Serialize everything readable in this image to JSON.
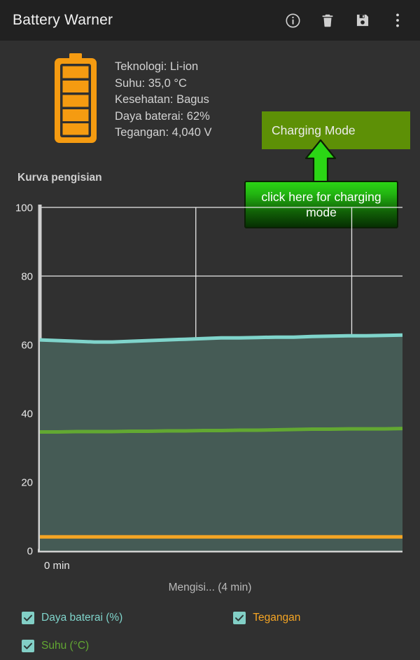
{
  "app": {
    "title": "Battery Warner"
  },
  "toolbar": {
    "icons": [
      {
        "name": "info-icon",
        "label": "Info"
      },
      {
        "name": "delete-icon",
        "label": "Delete"
      },
      {
        "name": "save-icon",
        "label": "Save"
      },
      {
        "name": "overflow-menu-icon",
        "label": "More options"
      }
    ]
  },
  "battery_info": {
    "technology": "Teknologi: Li-ion",
    "temperature": "Suhu: 35,0 °C",
    "health": "Kesehatan: Bagus",
    "level": "Daya baterai: 62%",
    "voltage": "Tegangan: 4,040 V"
  },
  "charging_button": {
    "label": "Charging Mode"
  },
  "tooltip": {
    "text": "click here for charging mode"
  },
  "chart": {
    "title": "Kurva pengisian",
    "x_axis_label": "0 min"
  },
  "status": {
    "text": "Mengisi... (4 min)"
  },
  "legend": {
    "items": [
      {
        "label": "Daya baterai (%)",
        "color": "#7fd4cb",
        "checked": true
      },
      {
        "label": "Tegangan",
        "color": "#f5a524",
        "checked": true
      },
      {
        "label": "Suhu (°C)",
        "color": "#62a832",
        "checked": true
      }
    ]
  },
  "colors": {
    "toolbar_bg": "#212121",
    "page_bg": "#303030",
    "accent_orange": "#f59b11",
    "battery_pct_line": "#7fd4cb",
    "battery_pct_fill": "#455b55",
    "temperature_line": "#62a832",
    "voltage_line": "#f5a524",
    "charging_btn_bg": "#5d9006",
    "tooltip_green": "#2bd615",
    "gridline": "#e8e8e8"
  },
  "chart_data": {
    "type": "line",
    "title": "Kurva pengisian",
    "xlabel": "0 min",
    "ylabel": "",
    "ylim": [
      0,
      100
    ],
    "yticks": [
      0,
      20,
      40,
      60,
      80,
      100
    ],
    "xlim": [
      0,
      4
    ],
    "xticks": [
      0
    ],
    "grid": true,
    "legend_position": "bottom",
    "x": [
      0,
      0.2,
      0.4,
      0.6,
      0.8,
      1.0,
      1.2,
      1.4,
      1.6,
      1.8,
      2.0,
      2.2,
      2.4,
      2.6,
      2.8,
      3.0,
      3.2,
      3.4,
      3.6,
      3.8,
      4.0
    ],
    "series": [
      {
        "name": "Daya baterai (%)",
        "color": "#7fd4cb",
        "filled": true,
        "values": [
          61.4,
          61.2,
          61.0,
          60.8,
          60.8,
          61.0,
          61.2,
          61.4,
          61.6,
          61.8,
          62.0,
          62.0,
          62.1,
          62.2,
          62.2,
          62.4,
          62.5,
          62.6,
          62.6,
          62.7,
          62.8
        ]
      },
      {
        "name": "Suhu (°C)",
        "color": "#62a832",
        "filled": false,
        "values": [
          34.6,
          34.6,
          34.7,
          34.7,
          34.7,
          34.8,
          34.8,
          34.9,
          34.9,
          35.0,
          35.0,
          35.1,
          35.1,
          35.2,
          35.3,
          35.4,
          35.4,
          35.5,
          35.5,
          35.5,
          35.6
        ]
      },
      {
        "name": "Tegangan",
        "color": "#f5a524",
        "filled": false,
        "values": [
          4.02,
          4.02,
          4.02,
          4.03,
          4.03,
          4.03,
          4.04,
          4.04,
          4.04,
          4.04,
          4.04,
          4.04,
          4.04,
          4.04,
          4.04,
          4.04,
          4.04,
          4.04,
          4.04,
          4.04,
          4.04
        ]
      }
    ]
  }
}
